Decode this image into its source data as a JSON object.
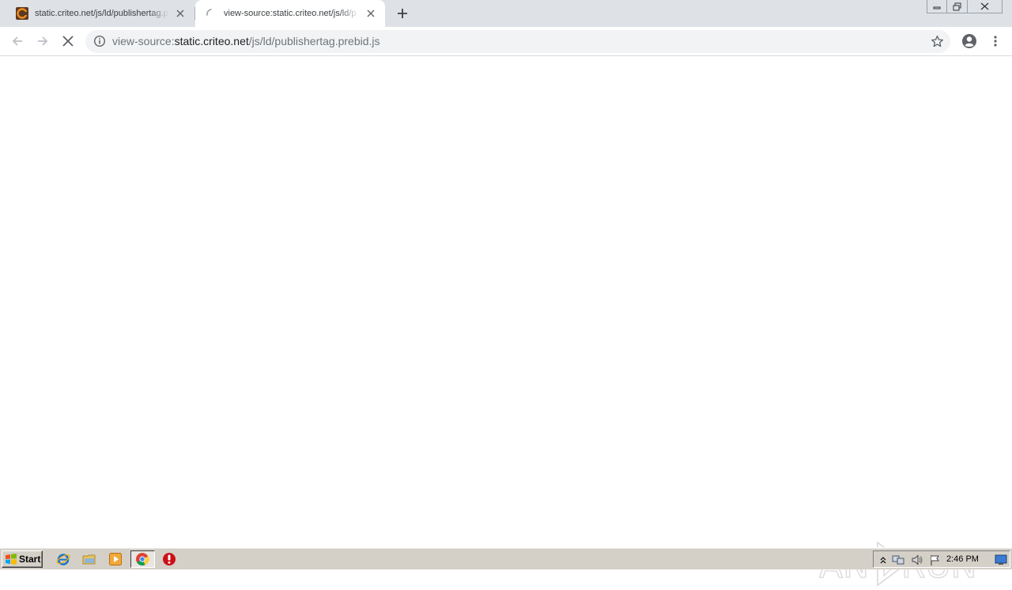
{
  "tabs": [
    {
      "title": "static.criteo.net/js/ld/publishertag.p",
      "active": false,
      "favicon": "criteo-favicon"
    },
    {
      "title": "view-source:static.criteo.net/js/ld/p",
      "active": true,
      "favicon": "loading-spinner-icon"
    }
  ],
  "omnibox": {
    "scheme": "view-source:",
    "host": "static.criteo.net",
    "path": "/js/ld/publishertag.prebid.js"
  },
  "taskbar": {
    "start_label": "Start",
    "clock": "2:46 PM",
    "pinned": [
      "internet-explorer-icon",
      "file-explorer-icon",
      "media-player-icon",
      "chrome-icon",
      "opera-icon"
    ]
  },
  "watermark": {
    "text": "ANY RUN"
  },
  "colors": {
    "tabstrip_bg": "#dee1e6",
    "omnibox_bg": "#f1f3f4",
    "taskbar_bg": "#d4d0c8",
    "text_primary": "#202124",
    "text_secondary": "#70757a"
  }
}
